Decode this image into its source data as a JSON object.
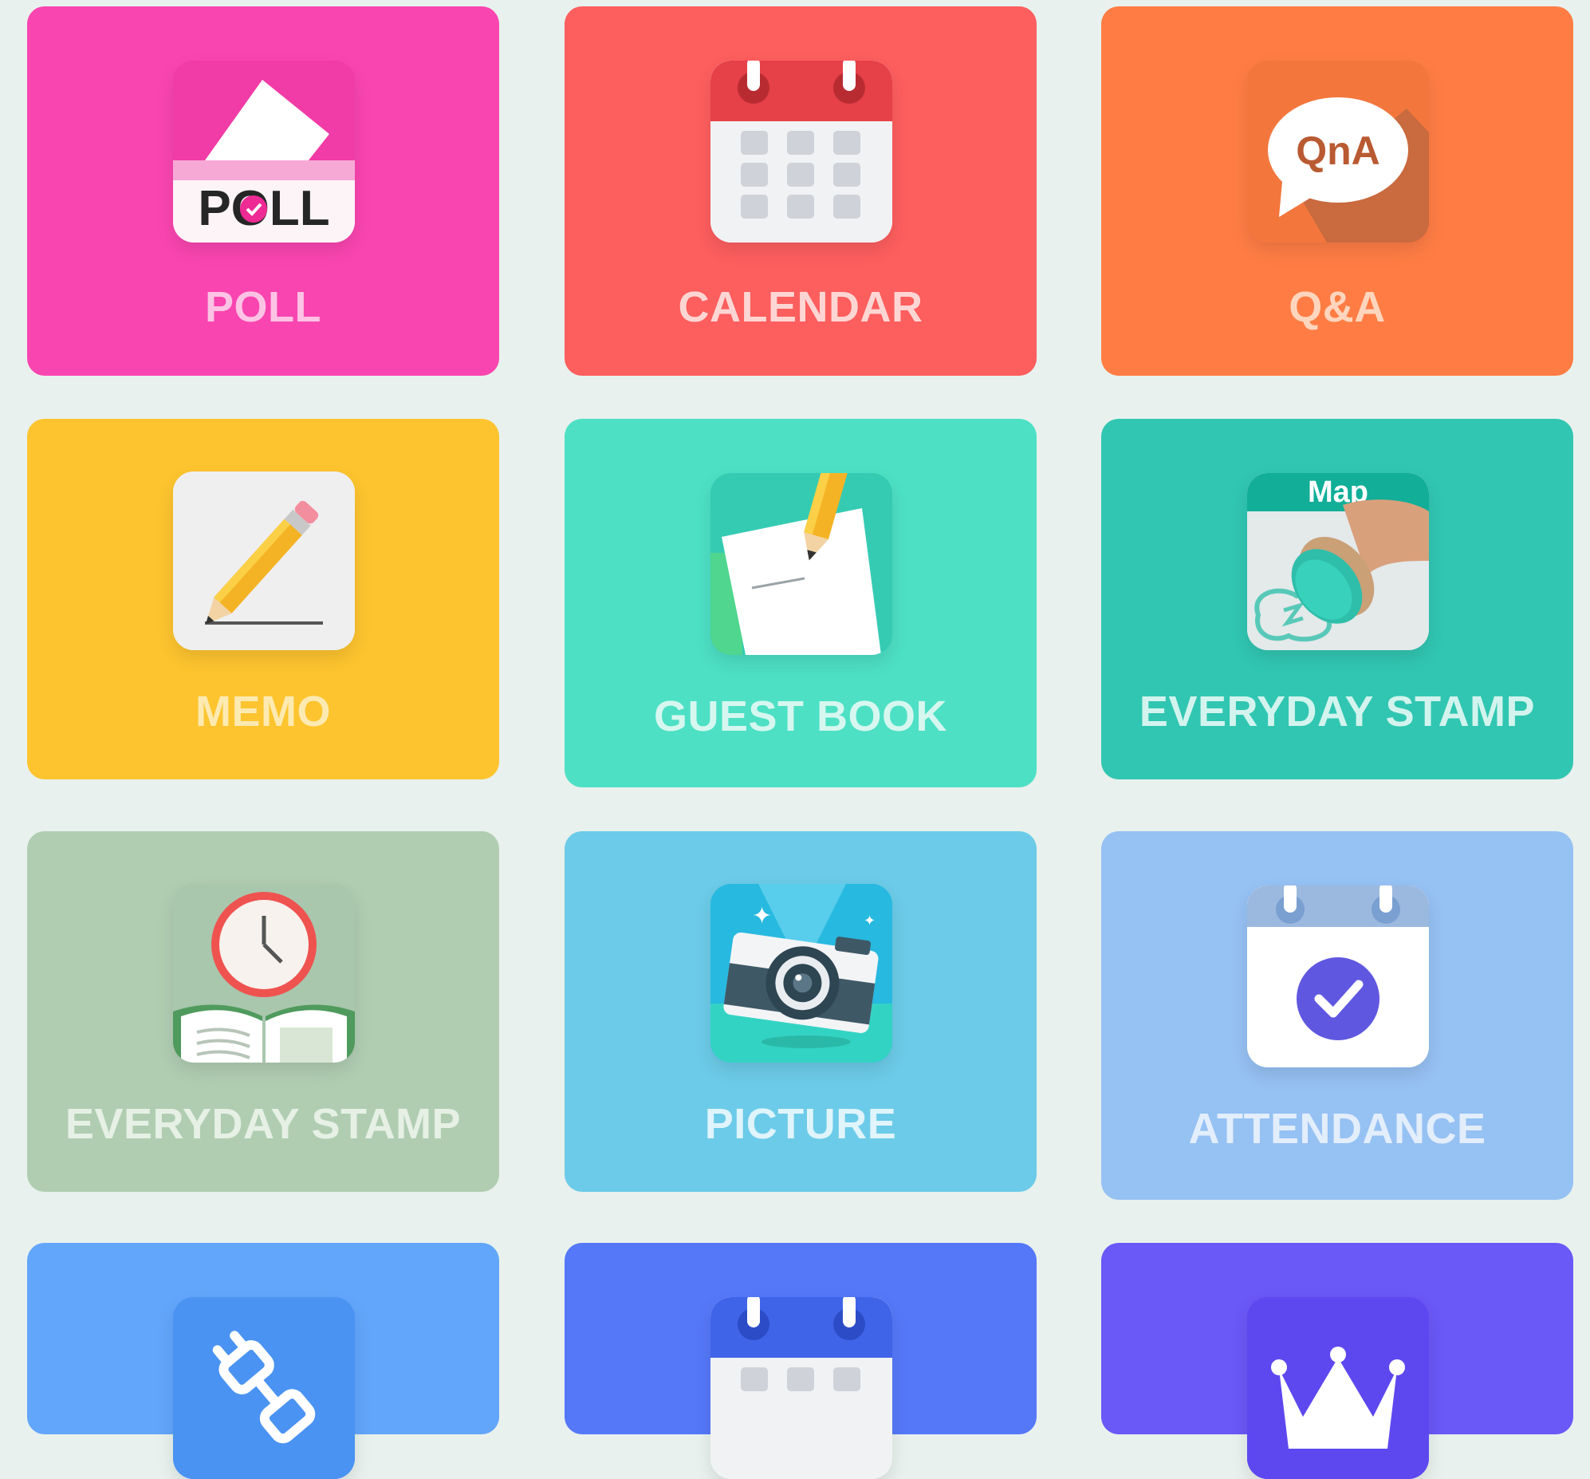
{
  "colors": {
    "background": "#e8f1ed",
    "poll": "#f945b0",
    "calendar": "#fd5e5e",
    "qna": "#ff7d45",
    "memo": "#fdc42f",
    "guest_book": "#4de0c5",
    "everyday_stamp_map": "#31c6b2",
    "everyday_stamp_study": "#b0cdb2",
    "picture": "#6ccbe8",
    "attendance": "#96c1f3",
    "row4_a": "#62a6fb",
    "row4_b": "#5578f9",
    "row4_c": "#6a58f7"
  },
  "apps": [
    {
      "label": "POLL",
      "icon": "poll-ballot-icon",
      "icon_text": "POLL"
    },
    {
      "label": "CALENDAR",
      "icon": "calendar-icon"
    },
    {
      "label": "Q&A",
      "icon": "qna-speech-bubble-icon",
      "icon_text": "QnA"
    },
    {
      "label": "MEMO",
      "icon": "pencil-memo-icon"
    },
    {
      "label": "GUEST BOOK",
      "icon": "guest-book-pencil-icon"
    },
    {
      "label": "EVERYDAY STAMP",
      "icon": "map-stamp-icon",
      "icon_text": "Map"
    },
    {
      "label": "EVERYDAY STAMP",
      "icon": "clock-book-icon"
    },
    {
      "label": "PICTURE",
      "icon": "camera-icon"
    },
    {
      "label": "ATTENDANCE",
      "icon": "attendance-check-calendar-icon"
    },
    {
      "label": "",
      "icon": "plug-icon"
    },
    {
      "label": "",
      "icon": "calendar-icon"
    },
    {
      "label": "",
      "icon": "crown-icon"
    }
  ]
}
